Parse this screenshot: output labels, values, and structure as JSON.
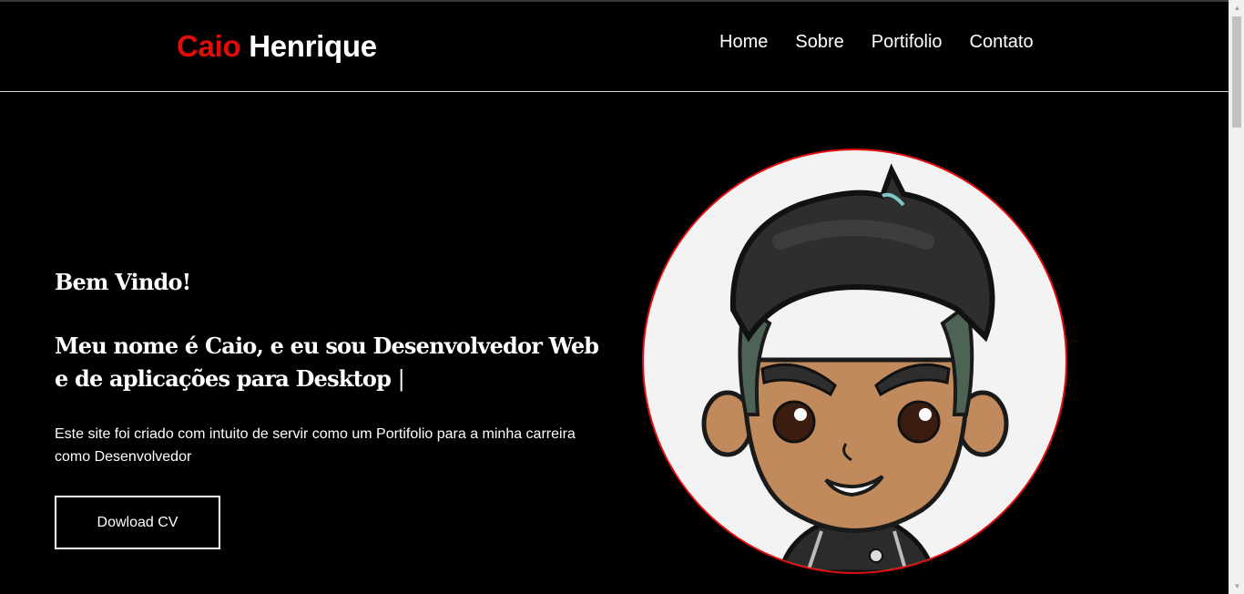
{
  "brand": {
    "first": "Caio",
    "last": "Henrique",
    "accent": "#e10c0c"
  },
  "nav": [
    {
      "label": "Home"
    },
    {
      "label": "Sobre"
    },
    {
      "label": "Portifolio"
    },
    {
      "label": "Contato"
    }
  ],
  "hero": {
    "welcome": "Bem Vindo!",
    "headline": "Meu nome é Caio, e eu sou Desenvolvedor Web e de aplicações para Desktop",
    "cursor": "|",
    "description": "Este site foi criado com intuito de servir como um Portifolio para a minha carreira como Desenvolvedor",
    "button_label": "Dowload CV"
  },
  "avatar": {
    "icon": "cartoon-avatar-image"
  },
  "scrollbar": {
    "up_icon": "▲",
    "down_icon": "▼"
  }
}
